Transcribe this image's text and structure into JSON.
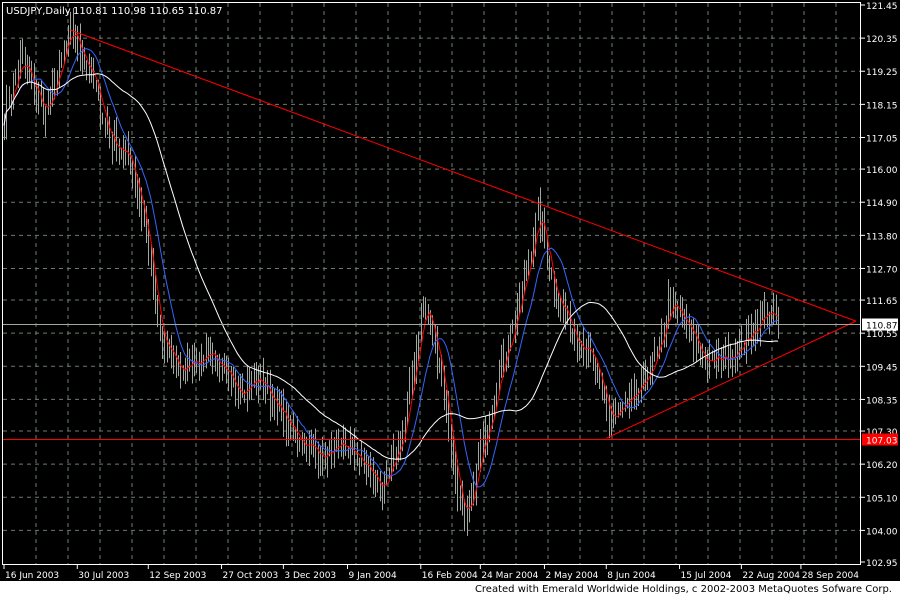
{
  "header": {
    "symbol": "USDJPY,Daily",
    "ohlc": "110.81 110.98 110.65 110.87"
  },
  "footer": {
    "credit": "Created with Emerald Worldwide Holdings, c 2002-2003 MetaQuotes Sofware Corp."
  },
  "colors": {
    "background": "#000000",
    "bars": "#a0a8a0",
    "grid": "#6e7a6e",
    "ma_fast": "#ff0000",
    "ma_mid": "#3366ff",
    "ma_slow": "#ffffff",
    "trendline": "#ff0000"
  },
  "chart_data": {
    "type": "ohlc-bar",
    "symbol": "USDJPY",
    "timeframe": "Daily",
    "ylim": [
      102.95,
      121.45
    ],
    "y_ticks": [
      "121.45",
      "120.35",
      "119.25",
      "118.15",
      "117.05",
      "116.00",
      "114.90",
      "113.80",
      "112.70",
      "111.65",
      "110.55",
      "109.45",
      "108.35",
      "107.30",
      "106.20",
      "105.10",
      "104.00",
      "102.95"
    ],
    "x_ticks": [
      {
        "label": "16 Jun 2003",
        "bar": 0
      },
      {
        "label": "30 Jul 2003",
        "bar": 32
      },
      {
        "label": "12 Sep 2003",
        "bar": 63
      },
      {
        "label": "27 Oct 2003",
        "bar": 95
      },
      {
        "label": "3 Dec 2003",
        "bar": 122
      },
      {
        "label": "9 Jan 2004",
        "bar": 150
      },
      {
        "label": "16 Feb 2004",
        "bar": 182
      },
      {
        "label": "24 Mar 2004",
        "bar": 208
      },
      {
        "label": "2 May 2004",
        "bar": 236
      },
      {
        "label": "8 Jun 2004",
        "bar": 263
      },
      {
        "label": "15 Jul 2004",
        "bar": 295
      },
      {
        "label": "22 Aug 2004",
        "bar": 322
      },
      {
        "label": "28 Sep 2004",
        "bar": 348
      }
    ],
    "bar_count": 356,
    "close_keypoints": [
      [
        0,
        117.8
      ],
      [
        7,
        119.6
      ],
      [
        18,
        117.8
      ],
      [
        29,
        120.6
      ],
      [
        37,
        119.3
      ],
      [
        46,
        117.0
      ],
      [
        55,
        116.3
      ],
      [
        61,
        114.3
      ],
      [
        68,
        110.3
      ],
      [
        77,
        109.3
      ],
      [
        90,
        110.0
      ],
      [
        99,
        108.7
      ],
      [
        112,
        109.0
      ],
      [
        125,
        107.3
      ],
      [
        138,
        106.5
      ],
      [
        151,
        106.7
      ],
      [
        166,
        105.3
      ],
      [
        175,
        107.6
      ],
      [
        183,
        111.6
      ],
      [
        190,
        109.6
      ],
      [
        196,
        106.3
      ],
      [
        201,
        104.0
      ],
      [
        207,
        106.3
      ],
      [
        216,
        109.3
      ],
      [
        225,
        111.6
      ],
      [
        233,
        114.6
      ],
      [
        240,
        112.0
      ],
      [
        248,
        110.6
      ],
      [
        255,
        110.0
      ],
      [
        264,
        107.7
      ],
      [
        275,
        108.3
      ],
      [
        286,
        110.0
      ],
      [
        290,
        111.6
      ],
      [
        299,
        110.6
      ],
      [
        307,
        109.5
      ],
      [
        320,
        110.0
      ],
      [
        333,
        111.3
      ],
      [
        338,
        110.87
      ]
    ],
    "moving_averages": [
      {
        "name": "fast",
        "period": 5
      },
      {
        "name": "mid",
        "period": 13
      },
      {
        "name": "slow",
        "period": 40
      }
    ],
    "trendlines": [
      {
        "name": "upper-resistance",
        "from": {
          "bar": 29,
          "price": 120.62
        },
        "to": {
          "bar": 372,
          "price": 110.95
        }
      },
      {
        "name": "lower-support",
        "from": {
          "bar": 263,
          "price": 107.06
        },
        "to": {
          "bar": 372,
          "price": 110.95
        }
      }
    ],
    "horizontal_lines": [
      {
        "name": "support",
        "price": 107.03,
        "label": "107.03"
      },
      {
        "name": "last-price",
        "price": 110.87,
        "label": "110.87"
      }
    ]
  }
}
